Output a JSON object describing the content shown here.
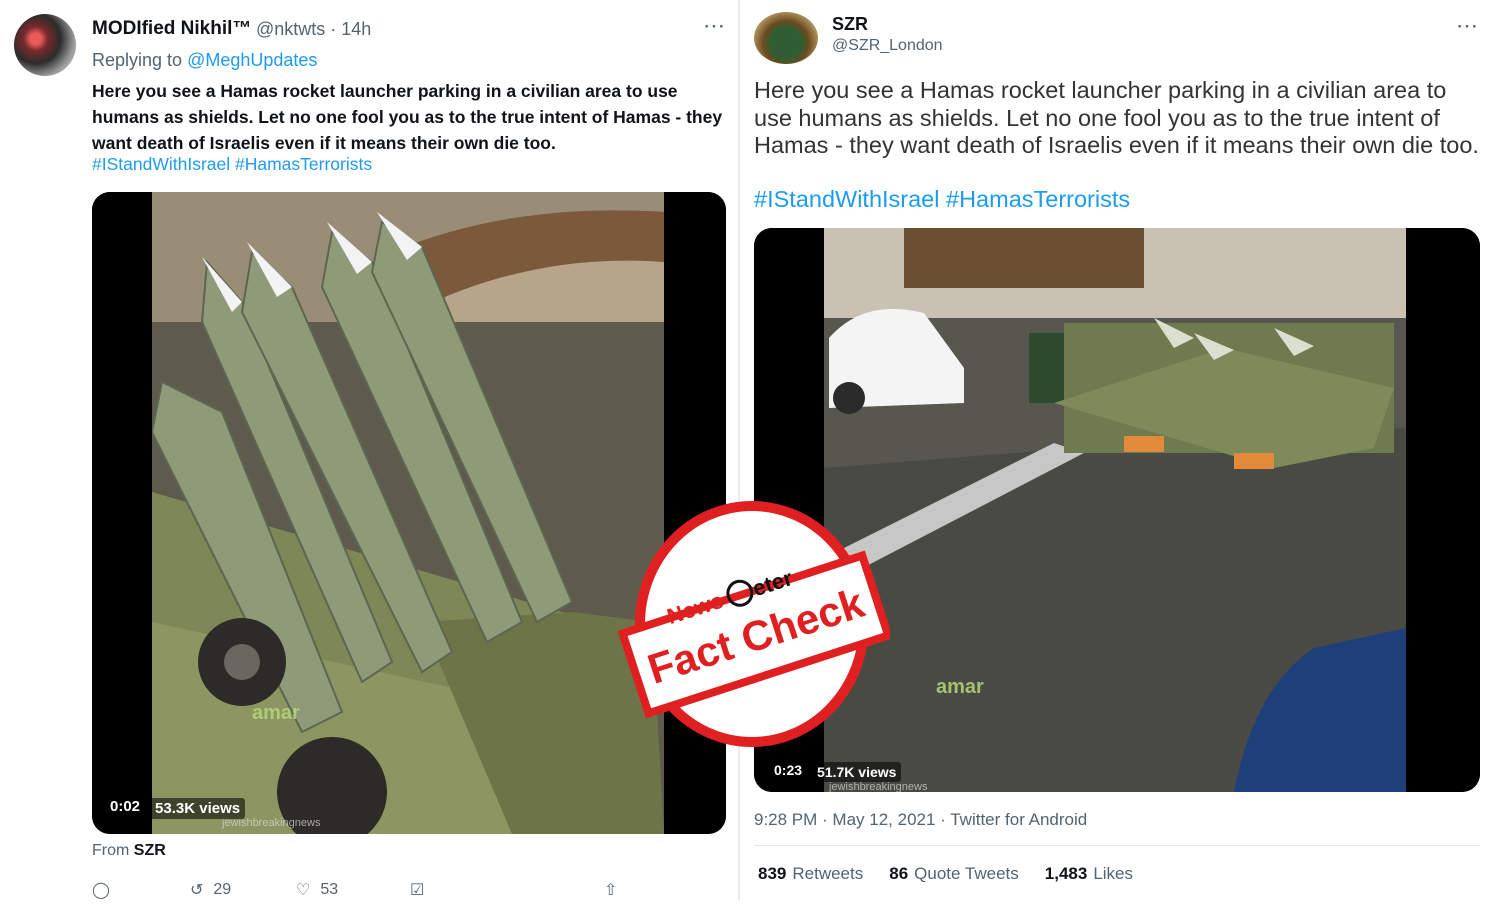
{
  "left_tweet": {
    "display_name": "MODIfied Nikhil™",
    "handle_time": "@nktwts · 14h",
    "reply_prefix": "Replying to",
    "reply_mention": "@MeghUpdates",
    "text": "Here you see a Hamas rocket launcher parking in a civilian area to use humans as shields. Let no one fool you as to the true intent of Hamas - they want death of Israelis even if it means their own die too.",
    "hashtags": "#IStandWithIsrael #HamasTerrorists",
    "video_time": "0:02",
    "video_views": "53.3K views",
    "watermark": "amar",
    "small_watermark": "jewishbreakingnews",
    "from_label": "From",
    "from_name": "SZR",
    "actions": {
      "retweets": "29",
      "likes": "53"
    }
  },
  "right_tweet": {
    "display_name": "SZR",
    "handle": "@SZR_London",
    "text": "Here you see a Hamas rocket launcher parking in a civilian area to use humans as shields. Let no one fool you as to the true intent of Hamas - they want death of Israelis even if it means their own die too.",
    "hashtags": "#IStandWithIsrael #HamasTerrorists",
    "video_time": "0:23",
    "video_views": "51.7K views",
    "watermark": "amar",
    "small_watermark": "jewishbreakingnews",
    "timestamp": "9:28 PM · May 12, 2021 · Twitter for Android",
    "stats": [
      {
        "count": "839",
        "label": "Retweets"
      },
      {
        "count": "86",
        "label": "Quote Tweets"
      },
      {
        "count": "1,483",
        "label": "Likes"
      }
    ]
  },
  "stamp": {
    "brand_a": "News",
    "brand_b": "eter",
    "headline": "Fact Check",
    "color": "#e02020"
  },
  "colors": {
    "link": "#1d9bf0",
    "muted": "#536471"
  },
  "icons": [
    "more-icon",
    "reply-icon",
    "retweet-icon",
    "like-icon",
    "bookmark-icon",
    "share-icon"
  ]
}
